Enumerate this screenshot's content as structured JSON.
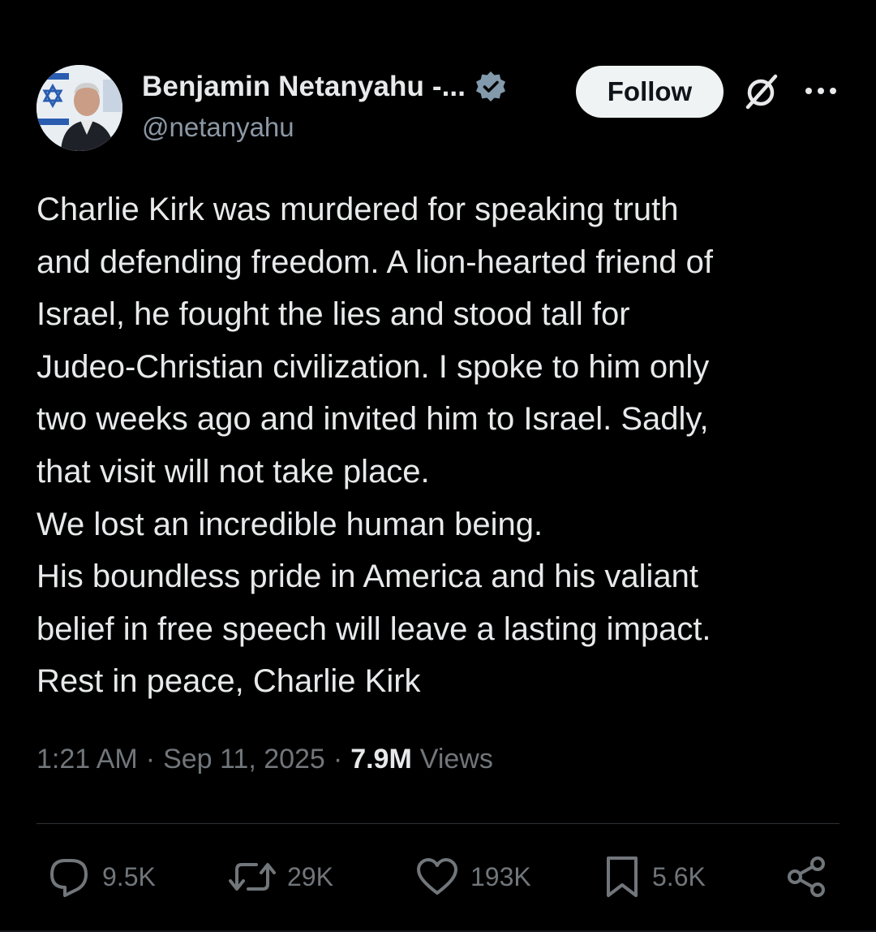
{
  "author": {
    "display_name": "Benjamin Netanyahu -...",
    "handle": "@netanyahu",
    "avatar": "avatar-photo-with-israeli-flag",
    "verified_icon": "verified-badge-icon",
    "verified_color": "#829aab"
  },
  "header": {
    "follow_label": "Follow",
    "grok_icon": "grok-icon",
    "more_icon": "more-options-icon"
  },
  "tweet": {
    "text": "Charlie Kirk was murdered for speaking truth\nand defending freedom. A lion-hearted friend of\nIsrael, he fought the lies and stood tall for\nJudeo-Christian civilization. I spoke to him only\ntwo weeks ago and invited him to Israel. Sadly,\nthat visit will not take place.\nWe lost an incredible human being.\nHis boundless pride in America and his valiant\nbelief in free speech will leave a lasting impact.\nRest in peace, Charlie Kirk"
  },
  "meta": {
    "time": "1:21 AM",
    "separator": "·",
    "date": "Sep 11, 2025",
    "views_count": "7.9M",
    "views_label": "Views"
  },
  "actions": {
    "replies": "9.5K",
    "reposts": "29K",
    "likes": "193K",
    "bookmarks": "5.6K",
    "share_icon": "share-icon"
  },
  "colors": {
    "background": "#000000",
    "text_primary": "#e7e9ea",
    "text_secondary": "#71767b",
    "follow_button_bg": "#eff3f4",
    "divider": "#2f3336"
  }
}
